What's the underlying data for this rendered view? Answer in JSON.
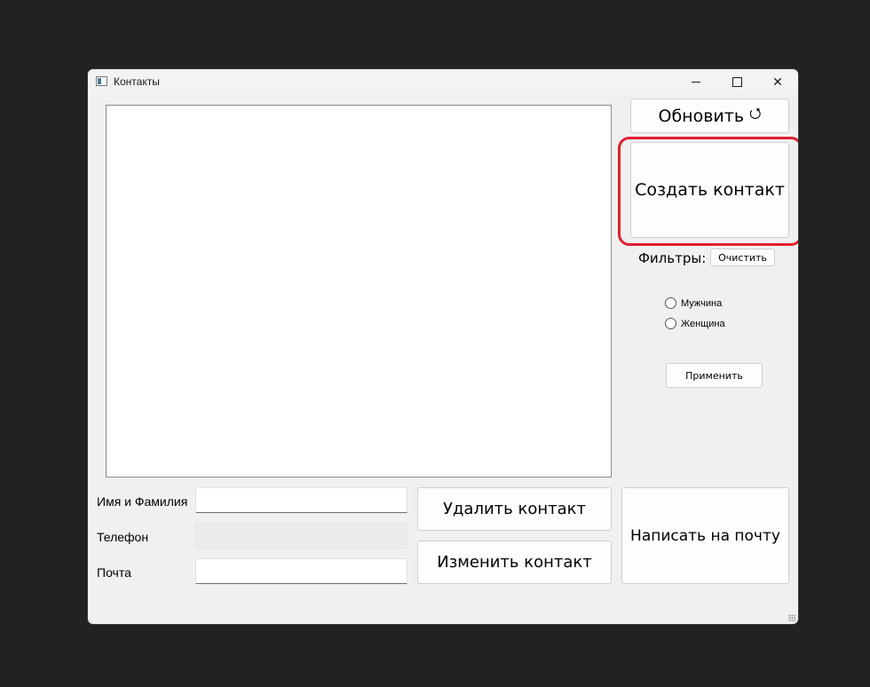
{
  "window": {
    "title": "Контакты"
  },
  "toolbar": {
    "refresh_label": "Обновить",
    "refresh_icon": "⭯",
    "create_label": "Создать контакт"
  },
  "filters": {
    "label": "Фильтры:",
    "clear_label": "Очистить",
    "options": [
      "Мужчина",
      "Женщина"
    ],
    "apply_label": "Применить"
  },
  "form": {
    "name_label": "Имя и Фамилия",
    "name_value": "",
    "phone_label": "Телефон",
    "phone_value": "",
    "email_label": "Почта",
    "email_value": ""
  },
  "actions": {
    "delete_label": "Удалить контакт",
    "edit_label": "Изменить контакт",
    "mail_label": "Написать на почту"
  },
  "highlight_color": "#e02030"
}
